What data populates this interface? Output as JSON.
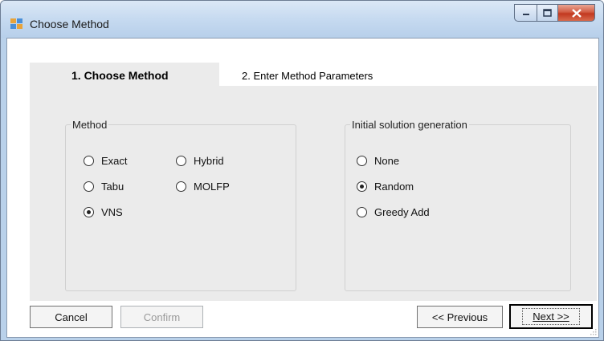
{
  "window": {
    "title": "Choose Method"
  },
  "tabs": [
    {
      "label": "1. Choose Method",
      "active": true
    },
    {
      "label": "2. Enter Method Parameters",
      "active": false
    }
  ],
  "method_group": {
    "legend": "Method",
    "options": [
      {
        "label": "Exact",
        "checked": false
      },
      {
        "label": "Hybrid",
        "checked": false
      },
      {
        "label": "Tabu",
        "checked": false
      },
      {
        "label": "MOLFP",
        "checked": false
      },
      {
        "label": "VNS",
        "checked": true
      }
    ]
  },
  "init_group": {
    "legend": "Initial solution generation",
    "options": [
      {
        "label": "None",
        "checked": false
      },
      {
        "label": "Random",
        "checked": true
      },
      {
        "label": "Greedy Add",
        "checked": false
      }
    ]
  },
  "buttons": {
    "cancel": "Cancel",
    "confirm": "Confirm",
    "previous": "<< Previous",
    "next": "Next >>"
  },
  "colors": {
    "frame": "#b9d1ea",
    "tab_page": "#ebebeb",
    "close_button": "#c2381f"
  }
}
